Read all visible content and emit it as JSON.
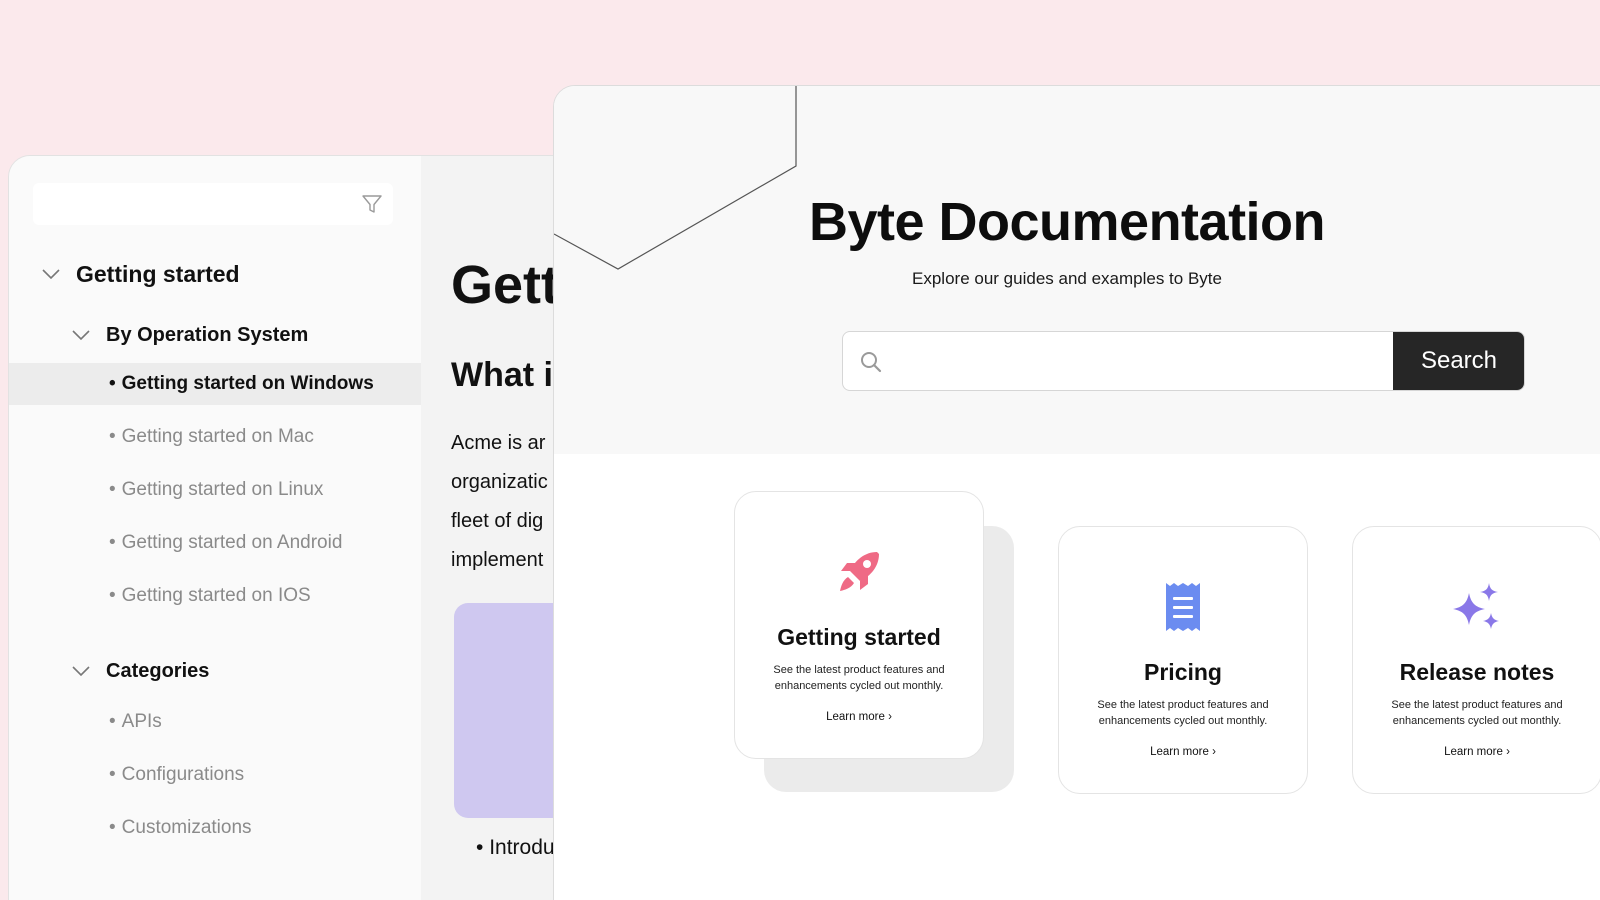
{
  "back_window": {
    "sidebar": {
      "search": {
        "placeholder": ""
      },
      "sections": [
        {
          "label": "Getting started",
          "groups": [
            {
              "label": "By Operation System",
              "items": [
                {
                  "label": "Getting started on Windows",
                  "active": true
                },
                {
                  "label": "Getting started on Mac"
                },
                {
                  "label": "Getting started on Linux"
                },
                {
                  "label": "Getting started on Android"
                },
                {
                  "label": "Getting started on IOS"
                }
              ]
            },
            {
              "label": "Categories",
              "items": [
                {
                  "label": "APIs"
                },
                {
                  "label": "Configurations"
                },
                {
                  "label": "Customizations"
                }
              ]
            }
          ]
        }
      ]
    },
    "content": {
      "title": "Gett",
      "subtitle": "What i",
      "paragraph_lines": [
        "Acme is ar",
        "organizatic",
        "fleet of dig",
        "implement"
      ],
      "bullet": "Introdu"
    }
  },
  "front_window": {
    "hero": {
      "title": "Byte Documentation",
      "subtitle": "Explore our guides and examples to Byte"
    },
    "search": {
      "placeholder": "",
      "button_label": "Search"
    },
    "cards": [
      {
        "icon": "rocket-icon",
        "icon_color": "#ef6a85",
        "title": "Getting started",
        "description": "See the latest product features and enhancements cycled out monthly.",
        "link": "Learn more ›"
      },
      {
        "icon": "receipt-icon",
        "icon_color": "#6b8cf0",
        "title": "Pricing",
        "description": "See the latest product features and enhancements cycled out monthly.",
        "link": "Learn more ›"
      },
      {
        "icon": "sparkles-icon",
        "icon_color": "#8a78e8",
        "title": "Release notes",
        "description": "See the latest product features and enhancements cycled out monthly.",
        "link": "Learn more ›"
      }
    ]
  },
  "colors": {
    "background": "#fbe9ec",
    "search_button": "#262626",
    "content_card": "#cfc8f0"
  }
}
